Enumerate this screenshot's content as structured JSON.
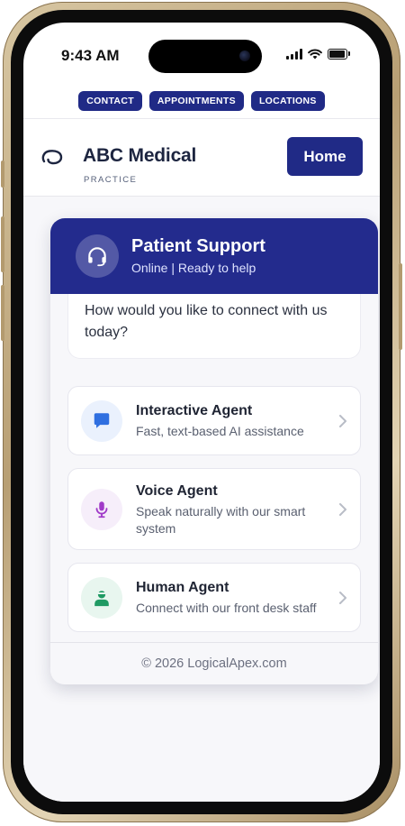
{
  "status_bar": {
    "time": "9:43 AM"
  },
  "top_nav": {
    "contact_label": "CONTACT",
    "appointments_label": "APPOINTMENTS",
    "locations_label": "LOCATIONS"
  },
  "header": {
    "brand": "ABC Medical",
    "brand_sub": "PRACTICE",
    "home_label": "Home"
  },
  "chat": {
    "title": "Patient Support",
    "status": "Online | Ready to help",
    "message": "How would you like to connect with us today?",
    "options": [
      {
        "title": "Interactive Agent",
        "desc": "Fast, text-based AI assistance",
        "icon": "chat-bubble-icon",
        "color": "#2f6fe0",
        "bg": "#eaf1fd"
      },
      {
        "title": "Voice Agent",
        "desc": "Speak naturally with our smart system",
        "icon": "microphone-icon",
        "color": "#a03ac8",
        "bg": "#f6eefa"
      },
      {
        "title": "Human Agent",
        "desc": "Connect with our front desk staff",
        "icon": "person-icon",
        "color": "#1f9a63",
        "bg": "#e8f6ef"
      }
    ],
    "footer": "© 2026 LogicalApex.com"
  },
  "colors": {
    "brand_navy": "#202a86",
    "text_dark": "#1d2540",
    "text_muted": "#5a6070"
  }
}
